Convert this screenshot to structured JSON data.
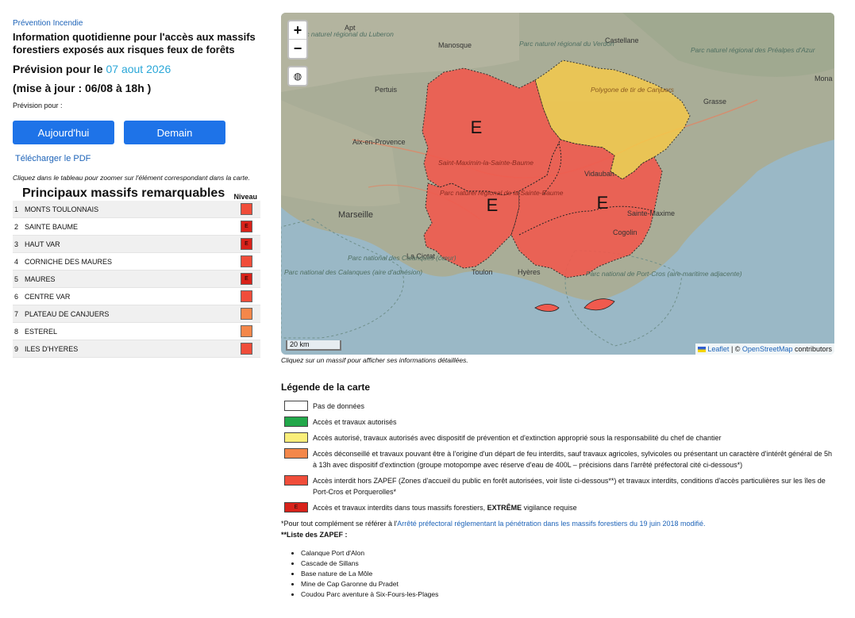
{
  "header": {
    "kicker": "Prévention Incendie",
    "title": "Information quotidienne pour l'accès aux massifs forestiers exposés aux risques feux de forêts",
    "forecast_prefix": "Prévision pour le",
    "forecast_date": "07 aout 2026",
    "update": "(mise à jour : 06/08 à 18h )",
    "forecast_for": "Prévision pour :"
  },
  "buttons": {
    "today": "Aujourd'hui",
    "tomorrow": "Demain"
  },
  "pdf_link": "Télécharger le PDF",
  "table_hint": "Cliquez dans le tableau pour zoomer sur l'élément correspondant dans la carte.",
  "table": {
    "heading": "Principaux massifs remarquables",
    "level_header": "Niveau",
    "rows": [
      {
        "num": "1",
        "name": "MONTS TOULONNAIS",
        "color": "#f04d3a",
        "mark": ""
      },
      {
        "num": "2",
        "name": "SAINTE BAUME",
        "color": "#d8221a",
        "mark": "E"
      },
      {
        "num": "3",
        "name": "HAUT VAR",
        "color": "#d8221a",
        "mark": "E"
      },
      {
        "num": "4",
        "name": "CORNICHE DES MAURES",
        "color": "#f04d3a",
        "mark": ""
      },
      {
        "num": "5",
        "name": "MAURES",
        "color": "#d8221a",
        "mark": "E"
      },
      {
        "num": "6",
        "name": "CENTRE VAR",
        "color": "#f04d3a",
        "mark": ""
      },
      {
        "num": "7",
        "name": "PLATEAU DE CANJUERS",
        "color": "#f4874a",
        "mark": ""
      },
      {
        "num": "8",
        "name": "ESTEREL",
        "color": "#f4874a",
        "mark": ""
      },
      {
        "num": "9",
        "name": "ILES D'HYERES",
        "color": "#f04d3a",
        "mark": ""
      }
    ]
  },
  "map": {
    "zoom_in": "+",
    "zoom_out": "−",
    "layers_icon": "◍",
    "zone_mark": "E",
    "scale": "20 km",
    "attribution_leaflet": "Leaflet",
    "attribution_sep": " | © ",
    "attribution_osm": "OpenStreetMap",
    "attribution_tail": " contributors",
    "hint": "Cliquez sur un massif pour afficher ses informations détaillées.",
    "place_labels": {
      "aix": "Aix-en-Provence",
      "marseille": "Marseille",
      "la_ciotat": "La Ciotat",
      "toulon": "Toulon",
      "hyeres": "Hyères",
      "vidauban": "Vidauban",
      "cogolin": "Cogolin",
      "sainte_maxime": "Sainte-Maxime",
      "manosque": "Manosque",
      "castellane": "Castellane",
      "grasse": "Grasse",
      "apt": "Apt",
      "pertuis": "Pertuis",
      "saint_maximin": "Saint-Maximin-la-Sainte-Baume",
      "pnr_luberon": "Parc naturel régional du Luberon",
      "pnr_verdon": "Parc naturel régional du Verdon",
      "pnr_prealpes": "Parc naturel régional des Préalpes d'Azur",
      "pnr_sainte_baume": "Parc naturel régional de la Sainte-Baume",
      "pn_calanques_coeur": "Parc national des Calanques (cœur)",
      "pn_calanques_adhesion": "Parc national des Calanques (aire d'adhésion)",
      "pn_portcros": "Parc national de Port-Cros (aire maritime adjacente)",
      "canjuers": "Polygone de tir de Canjuers",
      "menton": "Mona"
    },
    "colors": {
      "sea": "#9ab8c6",
      "land": "#a9ad97",
      "red": "#f05a4e",
      "yellow": "#f5c94a"
    }
  },
  "legend": {
    "title": "Légende de la carte",
    "items": [
      {
        "color": "#ffffff",
        "mark": "",
        "text": "Pas de données"
      },
      {
        "color": "#22a84a",
        "mark": "",
        "text": "Accès et travaux autorisés"
      },
      {
        "color": "#f9ee7a",
        "mark": "",
        "text": "Accès autorisé, travaux autorisés avec dispositif de prévention et d'extinction approprié sous la responsabilité du chef de chantier"
      },
      {
        "color": "#f4874a",
        "mark": "",
        "text": "Accès déconseillé et travaux pouvant être à l'origine d'un départ de feu interdits, sauf travaux agricoles, sylvicoles ou présentant un caractère d'intérêt général de 5h à 13h avec dispositif d'extinction (groupe motopompe avec réserve d'eau de 400L – précisions dans l'arrêté préfectoral cité ci-dessous*)"
      },
      {
        "color": "#f04d3a",
        "mark": "",
        "text": "Accès interdit hors ZAPEF (Zones d'accueil du public en forêt autorisées, voir liste ci-dessous**) et travaux interdits, conditions d'accès particulières sur les îles de Port-Cros et Porquerolles*"
      }
    ],
    "extreme": {
      "color": "#d8221a",
      "mark": "E",
      "text_before": "Accès et travaux interdits dans tous massifs forestiers, ",
      "text_bold": "EXTRÊME",
      "text_after": " vigilance requise"
    },
    "note_prefix": "*Pour tout complément se référer à l'",
    "note_link": "Arrêté préfectoral réglementant la pénétration dans les massifs forestiers du 19 juin 2018 modifié.",
    "zapef_title": "**Liste des ZAPEF :",
    "zapef": [
      "Calanque Port d'Alon",
      "Cascade de Sillans",
      "Base nature de La Môle",
      "Mine de Cap Garonne du Pradet",
      "Coudou Parc aventure à Six-Fours-les-Plages"
    ]
  }
}
